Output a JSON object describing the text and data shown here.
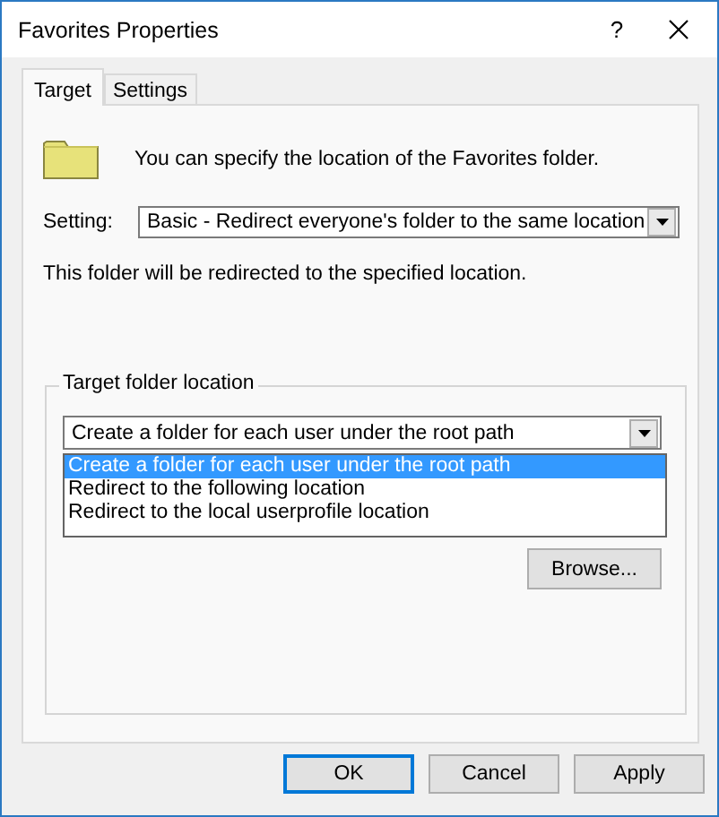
{
  "window": {
    "title": "Favorites Properties",
    "help": "?"
  },
  "tabs": [
    {
      "label": "Target",
      "selected": true
    },
    {
      "label": "Settings",
      "selected": false
    }
  ],
  "description": "You can specify the location of the Favorites folder.",
  "setting": {
    "label": "Setting:",
    "value": "Basic - Redirect everyone's folder to the same location"
  },
  "info": "This folder will be redirected to the specified location.",
  "target_group": {
    "legend": "Target folder location",
    "combo_value": "Create a folder for each user under the root path",
    "options": [
      {
        "label": "Create a folder for each user under the root path",
        "selected": true
      },
      {
        "label": "Redirect to the following location",
        "selected": false
      },
      {
        "label": "Redirect to the local userprofile location",
        "selected": false
      }
    ],
    "browse": "Browse..."
  },
  "buttons": [
    {
      "label": "OK",
      "default": true
    },
    {
      "label": "Cancel",
      "default": false
    },
    {
      "label": "Apply",
      "default": false
    }
  ]
}
